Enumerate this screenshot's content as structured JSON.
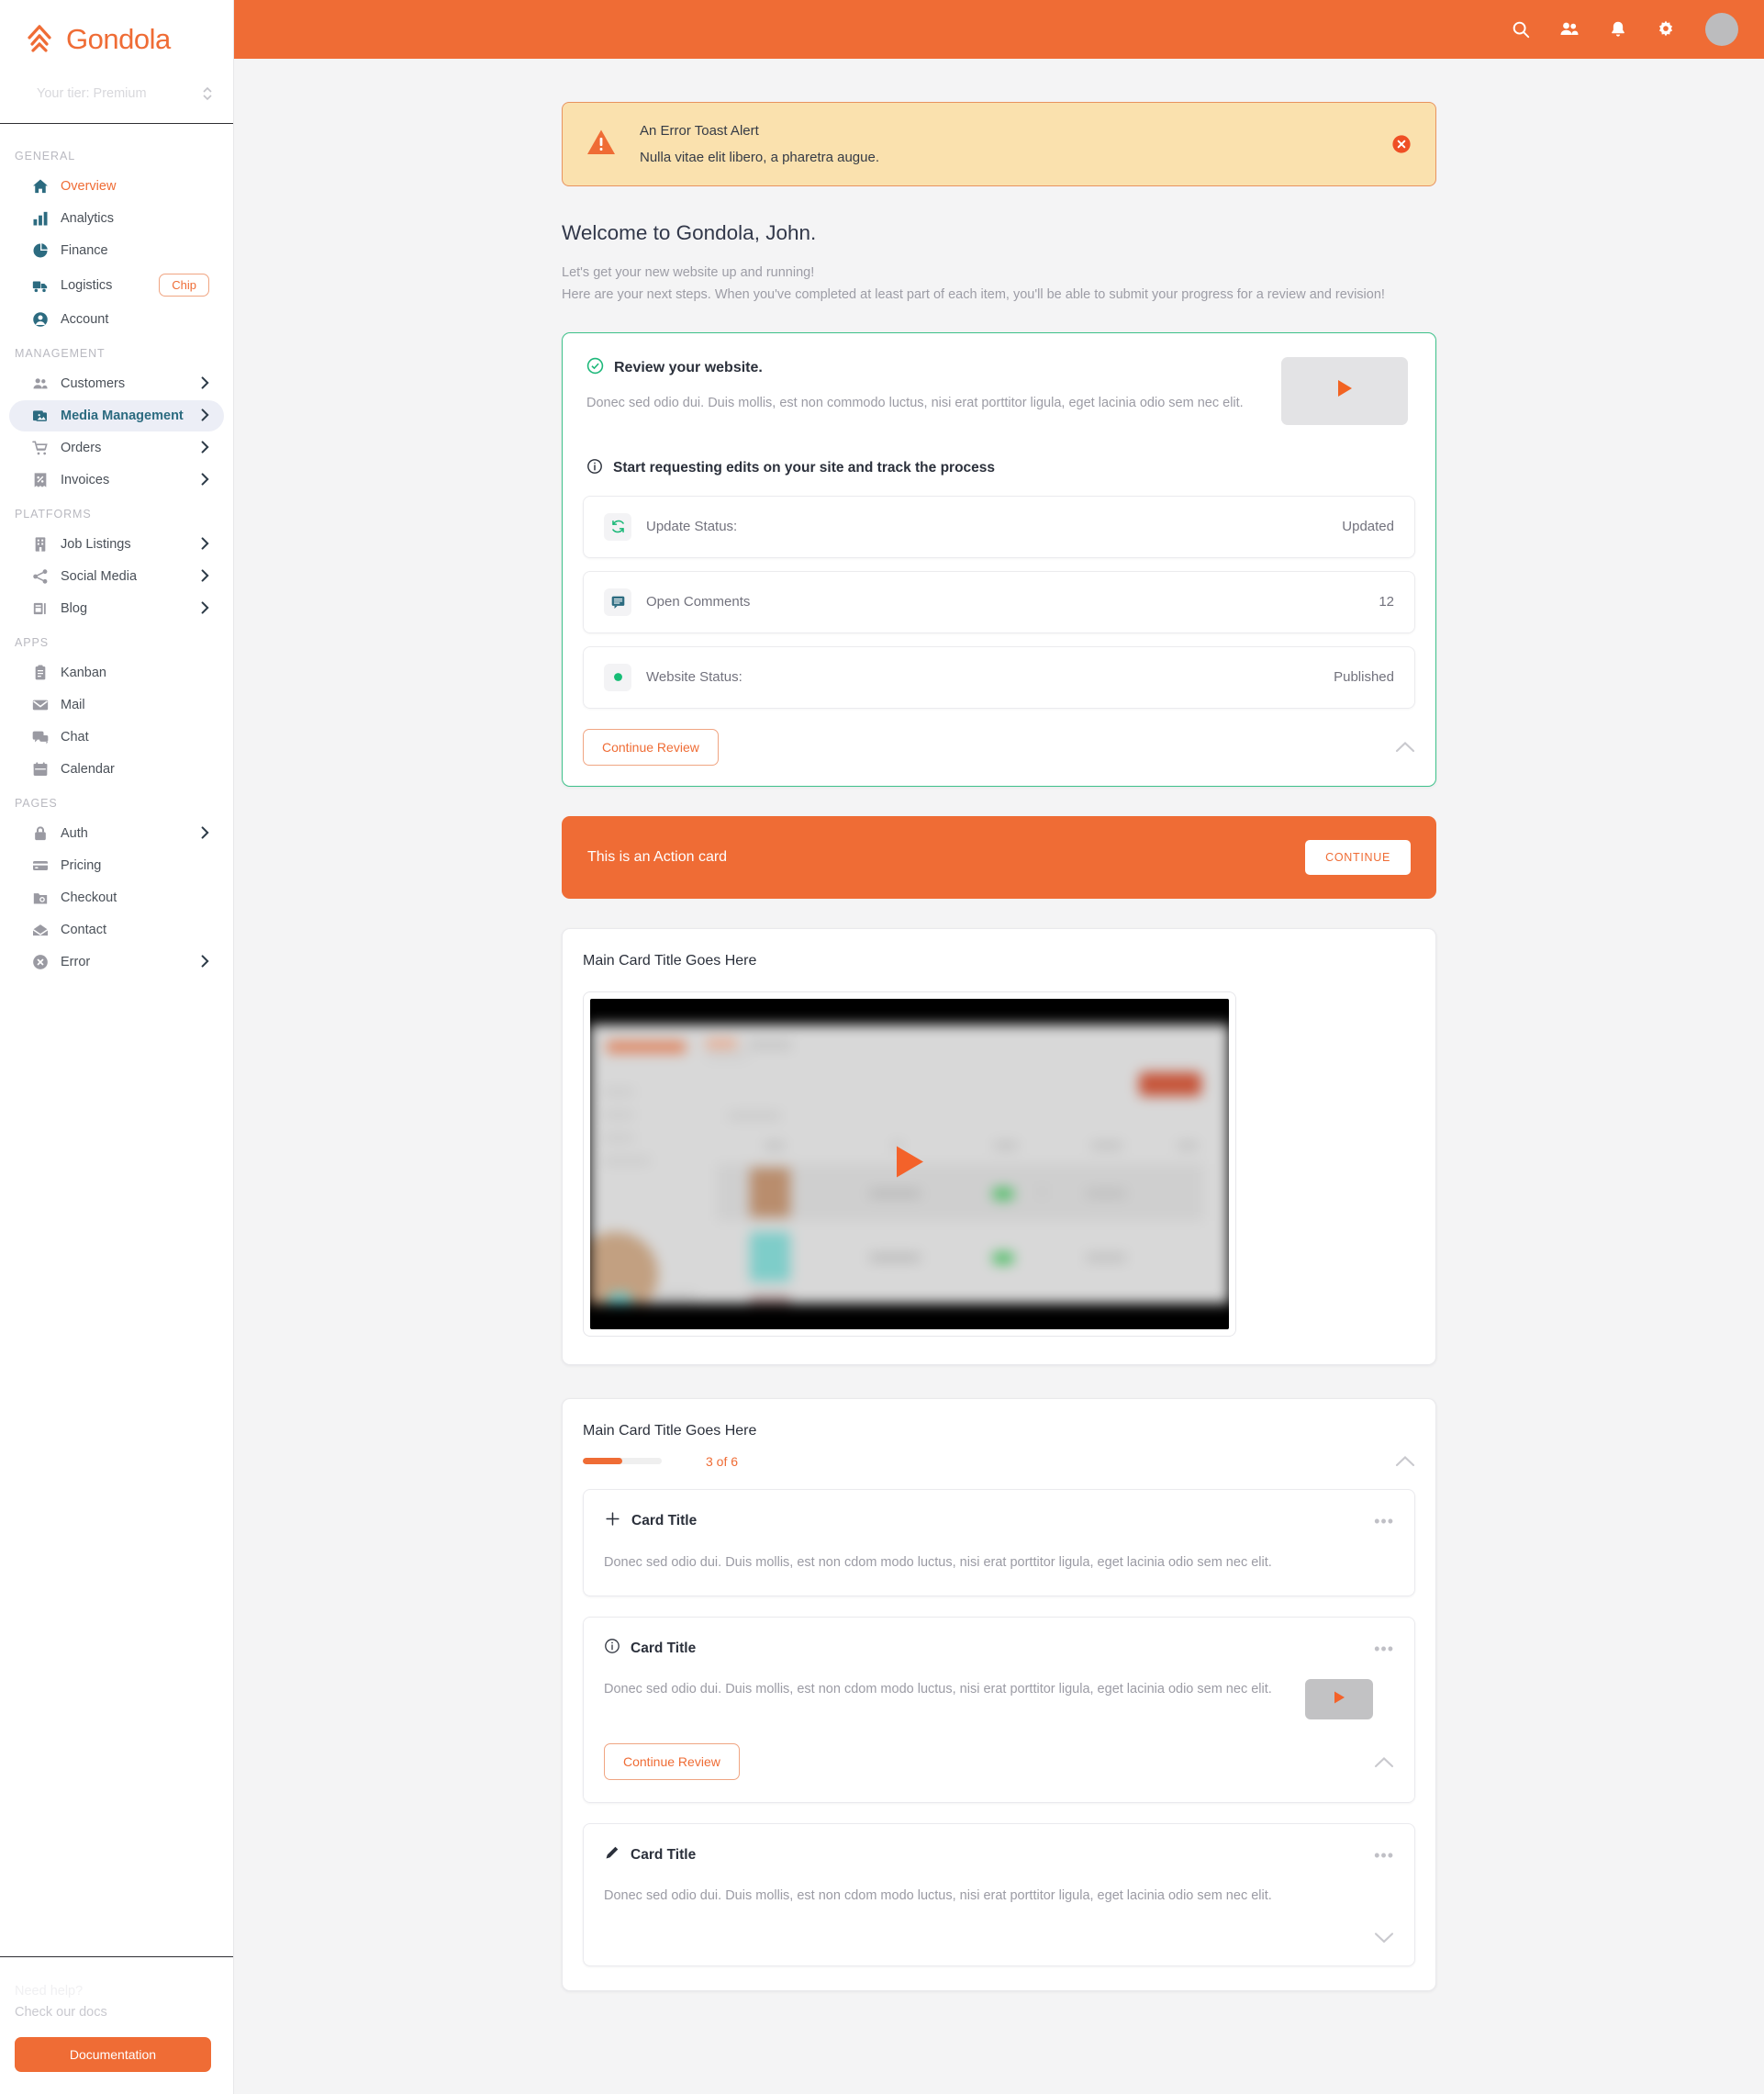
{
  "brand": {
    "name": "Gondola",
    "logo_icon": "gondola-logo-icon"
  },
  "sidebar": {
    "tier_text": "Your tier: Premium",
    "sections": [
      {
        "label": "GENERAL",
        "items": [
          {
            "label": "Overview",
            "icon": "home-icon",
            "state": "accent"
          },
          {
            "label": "Analytics",
            "icon": "bar-chart-icon",
            "state": "normal"
          },
          {
            "label": "Finance",
            "icon": "pie-chart-icon",
            "state": "normal"
          },
          {
            "label": "Logistics",
            "icon": "truck-icon",
            "state": "normal",
            "chip": "Chip"
          },
          {
            "label": "Account",
            "icon": "user-circle-icon",
            "state": "normal"
          }
        ]
      },
      {
        "label": "MANAGEMENT",
        "items": [
          {
            "label": "Customers",
            "icon": "users-icon",
            "state": "normal",
            "chevron": true
          },
          {
            "label": "Media Management",
            "icon": "photos-icon",
            "state": "active",
            "chevron": true
          },
          {
            "label": "Orders",
            "icon": "cart-icon",
            "state": "normal",
            "chevron": true
          },
          {
            "label": "Invoices",
            "icon": "receipt-icon",
            "state": "normal",
            "chevron": true
          }
        ]
      },
      {
        "label": "PLATFORMS",
        "items": [
          {
            "label": "Job  Listings",
            "icon": "building-icon",
            "state": "normal",
            "chevron": true
          },
          {
            "label": "Social  Media",
            "icon": "share-icon",
            "state": "normal",
            "chevron": true
          },
          {
            "label": "Blog",
            "icon": "article-icon",
            "state": "normal",
            "chevron": true
          }
        ]
      },
      {
        "label": "APPS",
        "items": [
          {
            "label": "Kanban",
            "icon": "clipboard-icon",
            "state": "normal"
          },
          {
            "label": "Mail",
            "icon": "envelope-icon",
            "state": "normal"
          },
          {
            "label": "Chat",
            "icon": "chat-icon",
            "state": "normal"
          },
          {
            "label": "Calendar",
            "icon": "calendar-icon",
            "state": "normal"
          }
        ]
      },
      {
        "label": "PAGES",
        "items": [
          {
            "label": "Auth",
            "icon": "lock-icon",
            "state": "normal",
            "chevron": true
          },
          {
            "label": "Pricing",
            "icon": "credit-card-icon",
            "state": "normal"
          },
          {
            "label": "Checkout",
            "icon": "camera-icon",
            "state": "normal"
          },
          {
            "label": "Contact",
            "icon": "mail-open-icon",
            "state": "normal"
          },
          {
            "label": "Error",
            "icon": "error-circle-icon",
            "state": "normal",
            "chevron": true
          }
        ]
      }
    ],
    "footer": {
      "help_line1": "Need help?",
      "help_line2": "Check our docs",
      "doc_button": "Documentation"
    }
  },
  "topbar": {
    "icons": [
      "search-icon",
      "people-icon",
      "bell-icon",
      "gear-icon"
    ],
    "avatar": "avatar"
  },
  "toast": {
    "icon": "warning-triangle-icon",
    "title": "An Error Toast Alert",
    "message": "Nulla vitae elit libero, a pharetra augue.",
    "close_icon": "close-circle-icon"
  },
  "welcome": {
    "title": "Welcome to Gondola, John.",
    "line1": "Let's get your new website up and running!",
    "line2": "Here are your next steps. When you've completed at least part of each item, you'll be able to submit your progress for a review and revision!"
  },
  "review_card": {
    "check_icon": "check-circle-icon",
    "title": "Review your website.",
    "description": "Donec sed odio dui. Duis mollis, est non commodo luctus, nisi erat porttitor ligula, eget lacinia odio sem nec elit.",
    "play_icon": "play-icon",
    "section_icon": "info-circle-icon",
    "section_title": "Start requesting edits on your site and track the process",
    "rows": [
      {
        "icon": "refresh-icon",
        "label": "Update Status:",
        "value": "Updated"
      },
      {
        "icon": "comment-icon",
        "label": "Open Comments",
        "value": "12"
      },
      {
        "icon": "status-dot-icon",
        "label": "Website Status:",
        "value": "Published"
      }
    ],
    "continue_button": "Continue Review",
    "collapse_icon": "chevron-up-icon"
  },
  "action_card": {
    "text": "This is an Action card",
    "button": "CONTINUE"
  },
  "media_card": {
    "title": "Main Card Title Goes Here",
    "play_icon": "play-icon"
  },
  "progress_card": {
    "title": "Main Card Title Goes Here",
    "progress_label": "3 of 6",
    "progress_percent": 50,
    "collapse_icon": "chevron-up-icon",
    "items": [
      {
        "icon": "plus-icon",
        "title": "Card Title",
        "description": "Donec sed odio dui. Duis mollis, est non cdom modo luctus, nisi erat porttitor ligula, eget lacinia odio sem nec elit.",
        "menu_icon": "ellipsis-icon",
        "has_thumb": false,
        "has_button": false,
        "toggle_icon": ""
      },
      {
        "icon": "info-circle-icon",
        "title": "Card Title",
        "description": "Donec sed odio dui. Duis mollis, est non cdom modo luctus, nisi erat porttitor ligula, eget lacinia odio sem nec elit.",
        "menu_icon": "ellipsis-icon",
        "has_thumb": true,
        "has_button": true,
        "button_label": "Continue Review",
        "toggle_icon": "chevron-up-icon"
      },
      {
        "icon": "pencil-icon",
        "title": "Card Title",
        "description": "Donec sed odio dui. Duis mollis, est non cdom modo luctus, nisi erat porttitor ligula, eget lacinia odio sem nec elit.",
        "menu_icon": "ellipsis-icon",
        "has_thumb": false,
        "has_button": false,
        "toggle_icon": "chevron-down-icon"
      }
    ]
  },
  "colors": {
    "brand_orange": "#ef6c35",
    "success_green": "#3ec18a",
    "toast_bg": "#fae1ae",
    "active_nav_bg": "#eceef6",
    "page_bg": "#f4f4f5"
  }
}
